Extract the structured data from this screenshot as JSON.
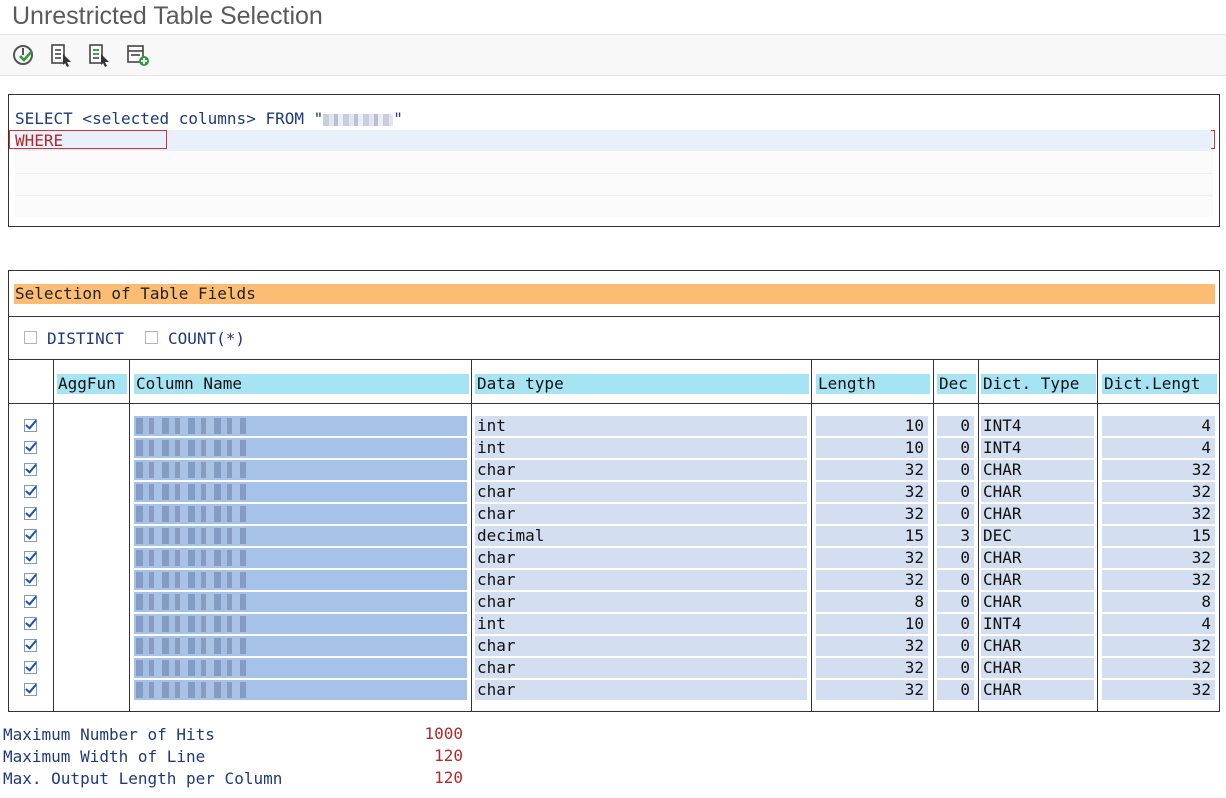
{
  "window": {
    "title": "Unrestricted Table Selection"
  },
  "toolbar": {
    "buttons": [
      {
        "icon": "execute-icon"
      },
      {
        "icon": "select-list-icon"
      },
      {
        "icon": "save-list-icon"
      },
      {
        "icon": "add-entry-icon"
      }
    ]
  },
  "editor": {
    "select_prefix": "SELECT <selected columns> FROM \"",
    "select_suffix": "\"",
    "where": "WHERE"
  },
  "selection": {
    "title": "Selection of Table Fields",
    "distinct_label": "DISTINCT",
    "count_label": "COUNT(*)",
    "headers": {
      "aggfun": "AggFun",
      "column_name": "Column Name",
      "data_type": "Data type",
      "length": "Length",
      "dec": "Dec",
      "dict_type": "Dict. Type",
      "dict_length": "Dict.Lengt"
    },
    "rows": [
      {
        "checked": true,
        "data_type": "int",
        "length": "10",
        "dec": "0",
        "dict_type": "INT4",
        "dict_length": "4"
      },
      {
        "checked": true,
        "data_type": "int",
        "length": "10",
        "dec": "0",
        "dict_type": "INT4",
        "dict_length": "4"
      },
      {
        "checked": true,
        "data_type": "char",
        "length": "32",
        "dec": "0",
        "dict_type": "CHAR",
        "dict_length": "32"
      },
      {
        "checked": true,
        "data_type": "char",
        "length": "32",
        "dec": "0",
        "dict_type": "CHAR",
        "dict_length": "32"
      },
      {
        "checked": true,
        "data_type": "char",
        "length": "32",
        "dec": "0",
        "dict_type": "CHAR",
        "dict_length": "32"
      },
      {
        "checked": true,
        "data_type": "decimal",
        "length": "15",
        "dec": "3",
        "dict_type": "DEC",
        "dict_length": "15"
      },
      {
        "checked": true,
        "data_type": "char",
        "length": "32",
        "dec": "0",
        "dict_type": "CHAR",
        "dict_length": "32"
      },
      {
        "checked": true,
        "data_type": "char",
        "length": "32",
        "dec": "0",
        "dict_type": "CHAR",
        "dict_length": "32"
      },
      {
        "checked": true,
        "data_type": "char",
        "length": "8",
        "dec": "0",
        "dict_type": "CHAR",
        "dict_length": "8"
      },
      {
        "checked": true,
        "data_type": "int",
        "length": "10",
        "dec": "0",
        "dict_type": "INT4",
        "dict_length": "4"
      },
      {
        "checked": true,
        "data_type": "char",
        "length": "32",
        "dec": "0",
        "dict_type": "CHAR",
        "dict_length": "32"
      },
      {
        "checked": true,
        "data_type": "char",
        "length": "32",
        "dec": "0",
        "dict_type": "CHAR",
        "dict_length": "32"
      },
      {
        "checked": true,
        "data_type": "char",
        "length": "32",
        "dec": "0",
        "dict_type": "CHAR",
        "dict_length": "32"
      }
    ]
  },
  "settings": [
    {
      "label": "Maximum Number of Hits",
      "value": "1000"
    },
    {
      "label": "Maximum Width of Line",
      "value": "120"
    },
    {
      "label": "Max. Output Length per Column",
      "value": "120"
    }
  ],
  "colors": {
    "section_header": "#fbbd74",
    "column_header": "#a7e4f3",
    "cell_bg": "#d3def0",
    "value_text": "#b02a2a",
    "label_text": "#1e3a7a"
  }
}
